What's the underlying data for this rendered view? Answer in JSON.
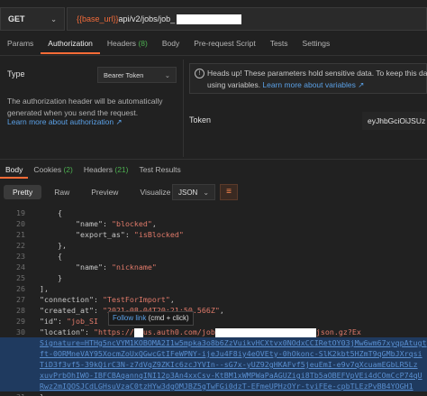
{
  "request": {
    "method": "GET",
    "url_var": "{{base_url}}",
    "url_path": "api/v2/jobs/job_"
  },
  "request_tabs": [
    {
      "label": "Params"
    },
    {
      "label": "Authorization",
      "active": true
    },
    {
      "label": "Headers",
      "count": "(8)"
    },
    {
      "label": "Body"
    },
    {
      "label": "Pre-request Script"
    },
    {
      "label": "Tests"
    },
    {
      "label": "Settings"
    }
  ],
  "auth": {
    "type_label": "Type",
    "type_value": "Bearer Token",
    "description": "The authorization header will be automatically generated when you send the request.",
    "learn_more": "Learn more about authorization ↗",
    "notice_line1": "Heads up! These parameters hold sensitive data. To keep this data",
    "notice_line2_pre": "using variables. ",
    "notice_link": "Learn more about variables ↗",
    "token_label": "Token",
    "token_value": "eyJhbGciOiJSUz"
  },
  "response_tabs": [
    {
      "label": "Body",
      "active": true
    },
    {
      "label": "Cookies",
      "count": "(2)"
    },
    {
      "label": "Headers",
      "count": "(21)"
    },
    {
      "label": "Test Results"
    }
  ],
  "view_modes": [
    "Pretty",
    "Raw",
    "Preview",
    "Visualize"
  ],
  "format": "JSON",
  "tooltip": {
    "link": "Follow link",
    "hint": "(cmd + click)"
  },
  "code": {
    "l19": "19",
    "l20": "20",
    "l21": "21",
    "l22": "22",
    "l23": "23",
    "l24": "24",
    "l25": "25",
    "l26": "26",
    "l27": "27",
    "l28": "28",
    "l29": "29",
    "l30": "30",
    "l31": "31",
    "name_key": "\"name\"",
    "blocked": "\"blocked\"",
    "export_key": "\"export_as\"",
    "isBlocked": "\"isBlocked\"",
    "nickname": "\"nickname\"",
    "connection_key": "\"connection\"",
    "connection_val": "\"TestForImport\"",
    "created_key": "\"created_at\"",
    "created_val": "\"2021-08-04T20:21:50.566Z\"",
    "id_key": "\"id\"",
    "id_val": "\"job_SI",
    "location_key": "\"location\"",
    "location_pre": "\"https://",
    "location_mid": "us.auth0.com/job",
    "location_end": "json.gz?Ex",
    "wrap1": "Signature=HTHg5ncVYM1KOBOMA2I1w5mpka3o8b6ZzVuikvHCXtvx0NOdxCCIRetOY03jMw6wm67xyqpAtugt",
    "wrap2": "ft-0ORMneVAY95XocmZoUxQGwcGtIFeWPNY-ijeJu4F8iy4eOVEty-0hOkonc-SlK2kbt5HZmT9qGMbJXrqsi",
    "wrap3": "TiD3f3vf5-39kQirC3N-z7dVqZ9ZKIc6zcJYVIn--sG7x-yUZ92gHKAFvf5jeuEmI-e9v7qXcuamEGbLR5Lz",
    "wrap4": "xuvPrbOhIWO-IBFCBAqannqINI12p3An4xxCsv-KtBM1xWMPWaPaAGUZigi8Tb5aOBEFVpVEi4dCOmCcP74qU",
    "wrap5": "Rwz2mIQOSJCdLGHsuVzaC0tzHYw3dgOMJBZ5gTwFGi0dzT-EFmeUPHzOYr-tviFEe-cpbTLEzPvBB4YOGH1"
  }
}
